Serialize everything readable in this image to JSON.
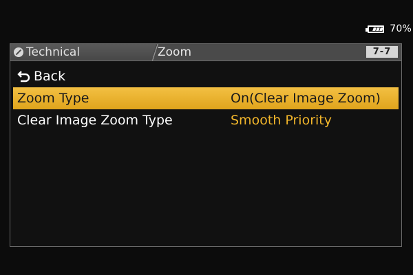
{
  "status": {
    "battery_percent": "70%",
    "battery_level": 0.7
  },
  "header": {
    "category": "Technical",
    "category_icon": "wrench-icon",
    "title": "Zoom",
    "page": "7-7"
  },
  "menu": {
    "back_label": "Back",
    "back_icon": "back-arrow-icon",
    "items": [
      {
        "label": "Zoom Type",
        "value": "On(Clear Image Zoom)",
        "selected": true
      },
      {
        "label": "Clear Image Zoom Type",
        "value": "Smooth Priority",
        "selected": false
      }
    ]
  },
  "colors": {
    "highlight": "#e9b02c",
    "value_text": "#f2b62b",
    "background": "#0c0c0c"
  }
}
